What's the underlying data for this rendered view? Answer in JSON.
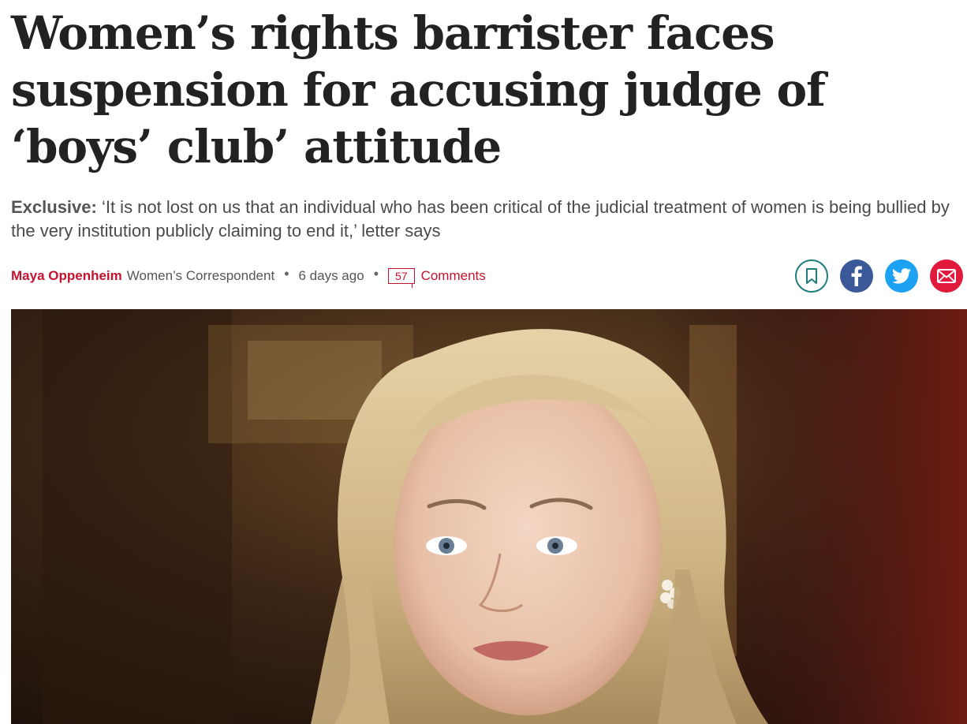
{
  "article": {
    "headline": "Women’s rights barrister faces suspension for accusing judge of ‘boys’ club’ attitude",
    "standfirst_label": "Exclusive:",
    "standfirst_text": " ‘It is not lost on us that an individual who has been critical of the judicial treatment of women is being bullied by the very institution publicly claiming to end it,’ letter says"
  },
  "byline": {
    "author": "Maya Oppenheim",
    "role": "Women’s Correspondent",
    "separator": "•",
    "time": "6 days ago",
    "comment_count": "57",
    "comments_label": "Comments"
  },
  "share": {
    "icons": [
      "bookmark-icon",
      "facebook-icon",
      "twitter-icon",
      "email-icon"
    ]
  },
  "colors": {
    "accent_red": "#c4122f",
    "bookmark_teal": "#1e7d7b",
    "facebook": "#3b5998",
    "twitter": "#1da1f2",
    "email": "#e0193d"
  }
}
